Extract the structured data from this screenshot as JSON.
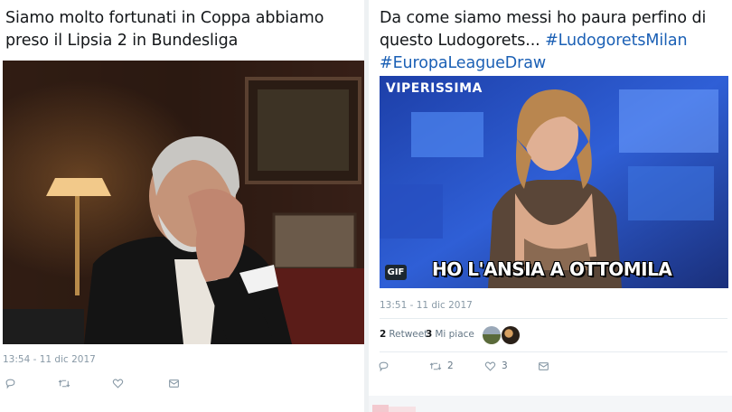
{
  "tweets": [
    {
      "text": "Siamo molto fortunati in Coppa abbiamo preso il Lipsia 2 in Bundesliga",
      "timestamp": "13:54 - 11 dic 2017",
      "media": "photo of grey-haired bearded man in dark jacket covering his face with his hand, lamp and painting in background"
    },
    {
      "text_plain": "Da come siamo messi ho paura perfino di questo Ludogorets... ",
      "hashtags": [
        "#LudogoretsMilan",
        "#EuropaLeagueDraw"
      ],
      "timestamp": "13:51 - 11 dic 2017",
      "gif": {
        "watermark": "VIPERISSIMA",
        "caption": "HO L'ANSIA A OTTOMILA",
        "badge": "GIF"
      },
      "stats": {
        "retweets_count": "2",
        "retweets_label": "Retweet",
        "likes_count": "3",
        "likes_label": "Mi piace"
      },
      "actions": {
        "retweet_count": "2",
        "like_count": "3"
      }
    }
  ],
  "icons": [
    "reply-icon",
    "retweet-icon",
    "heart-icon",
    "message-icon"
  ],
  "colors": {
    "hashtag": "#1b60b5",
    "muted": "#8899a6",
    "text": "#14171a"
  }
}
